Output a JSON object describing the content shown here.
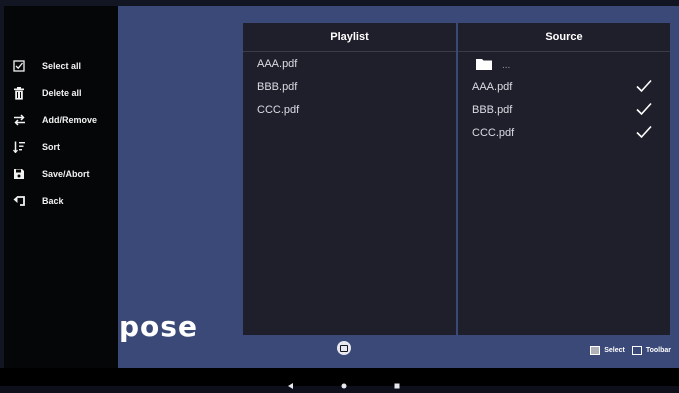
{
  "background": {
    "partial_title": "pose"
  },
  "sidebar": {
    "items": [
      {
        "label": "Select all",
        "icon": "checkbox-icon"
      },
      {
        "label": "Delete all",
        "icon": "trash-icon"
      },
      {
        "label": "Add/Remove",
        "icon": "swap-icon"
      },
      {
        "label": "Sort",
        "icon": "sort-icon"
      },
      {
        "label": "Save/Abort",
        "icon": "save-icon"
      },
      {
        "label": "Back",
        "icon": "back-icon"
      }
    ]
  },
  "playlist": {
    "title": "Playlist",
    "files": [
      "AAA.pdf",
      "BBB.pdf",
      "CCC.pdf"
    ]
  },
  "source": {
    "title": "Source",
    "folder_label": "...",
    "files": [
      {
        "name": "AAA.pdf",
        "checked": true
      },
      {
        "name": "BBB.pdf",
        "checked": true
      },
      {
        "name": "CCC.pdf",
        "checked": true
      }
    ]
  },
  "legend": {
    "select_label": "Select",
    "toolbar_label": "Toolbar"
  },
  "colors": {
    "background_area": "#3a4978",
    "sidebar": "#050608",
    "panel": "#1e1f2a"
  }
}
